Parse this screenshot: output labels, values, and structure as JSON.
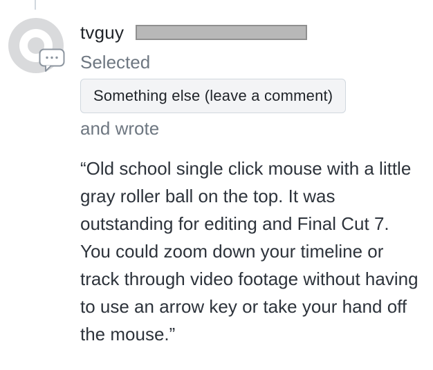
{
  "response": {
    "username": "tvguy",
    "selected_label": "Selected",
    "choice": "Something else (leave a comment)",
    "wrote_label": "and wrote",
    "quote": "“Old school single click mouse with a little gray roller ball on the top. It was outstanding for editing and Final Cut 7. You could zoom down your timeline or track through video footage without having to use an arrow key or take your hand off the mouse.”"
  },
  "icons": {
    "avatar": "default-avatar-icon",
    "badge": "comment-bubble-icon"
  },
  "colors": {
    "text": "#1f2328",
    "muted": "#6e7781",
    "pill_bg": "#f3f4f6",
    "pill_border": "#d0d7de",
    "redaction": "#b8b8b8"
  }
}
